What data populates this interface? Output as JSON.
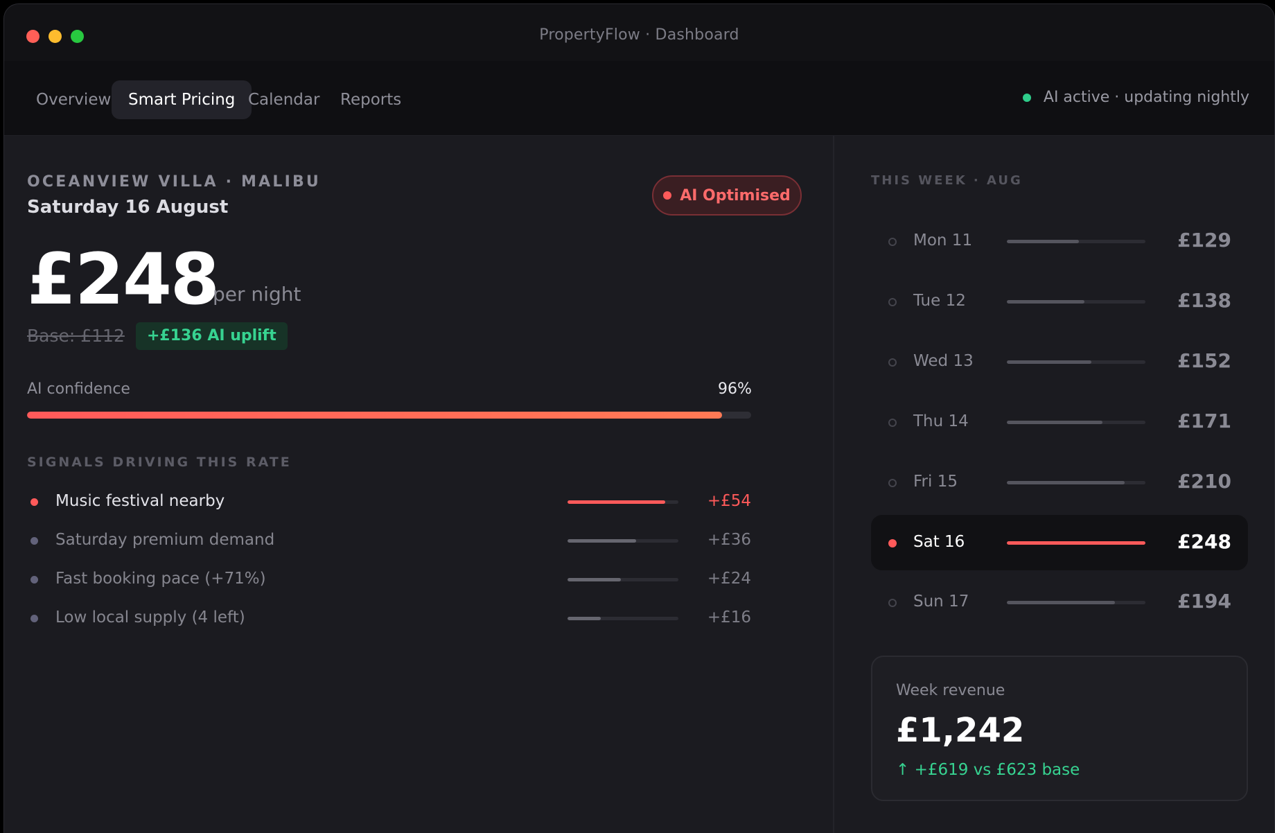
{
  "window": {
    "title": "PropertyFlow · Dashboard"
  },
  "nav": {
    "tabs": [
      {
        "label": "Overview"
      },
      {
        "label": "Smart Pricing",
        "active": true
      },
      {
        "label": "Calendar"
      },
      {
        "label": "Reports"
      }
    ],
    "status": "AI active · updating nightly",
    "status_color": "#2ecc8a"
  },
  "property": {
    "name": "OCEANVIEW VILLA · MALIBU",
    "date": "Saturday 16 August",
    "badge": "AI Optimised",
    "price": "£248",
    "price_unit": "per night",
    "base": "Base: £112",
    "uplift": "+£136 AI uplift"
  },
  "confidence": {
    "label": "AI confidence",
    "value": "96%",
    "fraction": 0.96
  },
  "signals": {
    "heading": "SIGNALS DRIVING THIS RATE",
    "items": [
      {
        "label": "Music festival nearby",
        "value": "+£54",
        "level": 0.88,
        "hot": true
      },
      {
        "label": "Saturday premium demand",
        "value": "+£36",
        "level": 0.62,
        "hot": false
      },
      {
        "label": "Fast booking pace (+71%)",
        "value": "+£24",
        "level": 0.48,
        "hot": false
      },
      {
        "label": "Low local supply (4 left)",
        "value": "+£16",
        "level": 0.3,
        "hot": false
      }
    ]
  },
  "week": {
    "heading": "THIS WEEK · AUG",
    "days": [
      {
        "label": "Mon 11",
        "price": "£129",
        "level": 0.52
      },
      {
        "label": "Tue 12",
        "price": "£138",
        "level": 0.56
      },
      {
        "label": "Wed 13",
        "price": "£152",
        "level": 0.61
      },
      {
        "label": "Thu 14",
        "price": "£171",
        "level": 0.69
      },
      {
        "label": "Fri 15",
        "price": "£210",
        "level": 0.85
      },
      {
        "label": "Sat 16",
        "price": "£248",
        "level": 1.0,
        "active": true
      },
      {
        "label": "Sun 17",
        "price": "£194",
        "level": 0.78
      }
    ]
  },
  "revenue": {
    "label": "Week revenue",
    "value": "£1,242",
    "delta": "↑ +£619 vs £623 base"
  },
  "colors": {
    "accent": "#ff5a5a",
    "positive": "#37d391"
  }
}
